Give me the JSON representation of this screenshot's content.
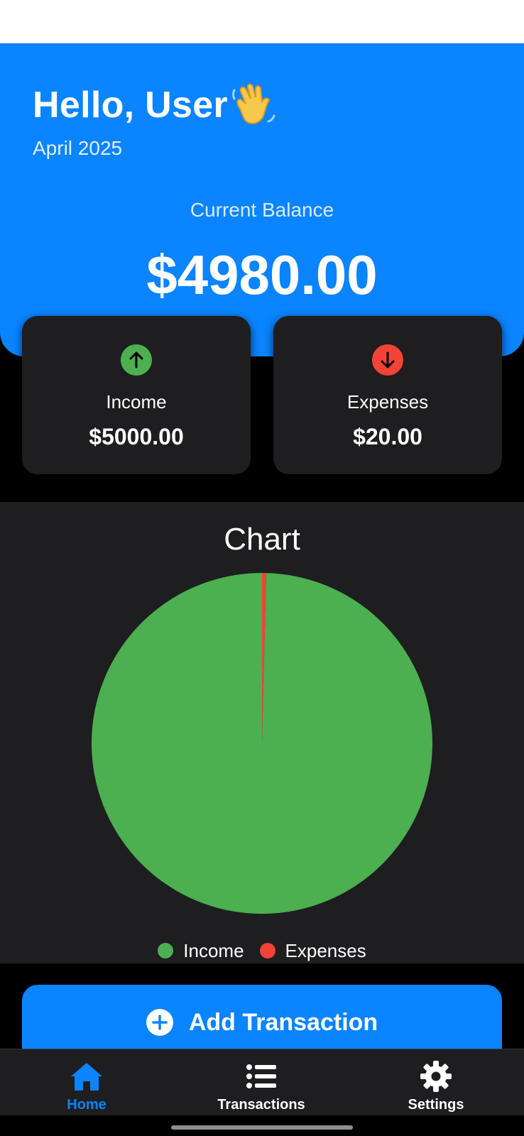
{
  "header": {
    "greeting": "Hello, User",
    "wave_emoji": "👋",
    "month": "April 2025",
    "balance_label": "Current Balance",
    "balance_value": "$4980.00"
  },
  "summary": {
    "income": {
      "label": "Income",
      "value": "$5000.00",
      "icon": "arrow-up-icon",
      "color": "#4caf50"
    },
    "expenses": {
      "label": "Expenses",
      "value": "$20.00",
      "icon": "arrow-down-icon",
      "color": "#f44336"
    }
  },
  "chart": {
    "title": "Chart"
  },
  "chart_data": {
    "type": "pie",
    "title": "Chart",
    "categories": [
      "Income",
      "Expenses"
    ],
    "values": [
      5000,
      20
    ],
    "colors": [
      "#4caf50",
      "#f44336"
    ],
    "legend_position": "bottom"
  },
  "actions": {
    "add_transaction_label": "Add Transaction",
    "add_icon": "plus-circle-icon"
  },
  "nav": {
    "items": [
      {
        "label": "Home",
        "icon": "home-icon",
        "active": true
      },
      {
        "label": "Transactions",
        "icon": "list-icon",
        "active": false
      },
      {
        "label": "Settings",
        "icon": "gear-icon",
        "active": false
      }
    ],
    "active_color": "#0a84ff",
    "inactive_color": "#ffffff"
  },
  "theme": {
    "accent": "#0a84ff",
    "surface": "#1e1e20",
    "background": "#000000"
  }
}
